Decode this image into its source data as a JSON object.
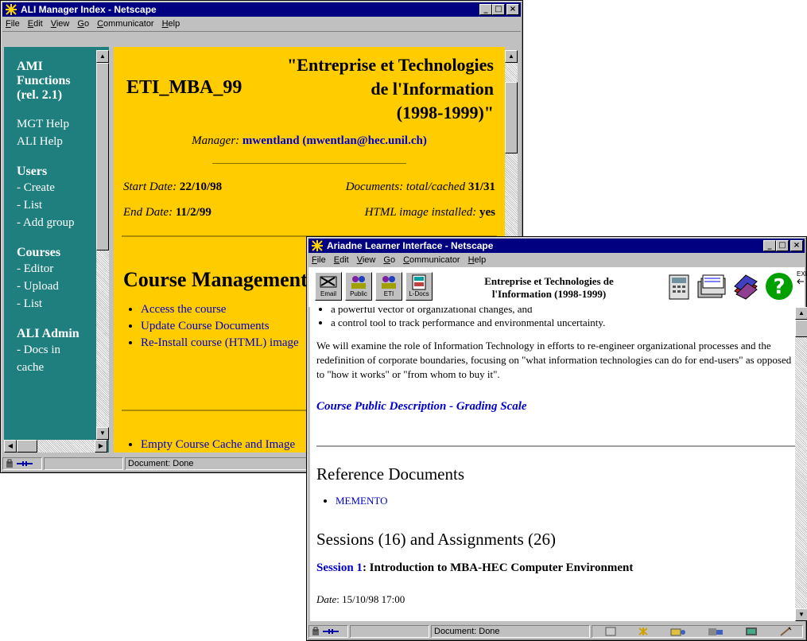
{
  "manager_window": {
    "title": "ALI Manager Index - Netscape",
    "menu": [
      "File",
      "Edit",
      "View",
      "Go",
      "Communicator",
      "Help"
    ],
    "status": "Document: Done",
    "sidebar": {
      "heading": [
        "AMI",
        "Functions",
        "(rel. 2.1)"
      ],
      "help_links": [
        "MGT Help",
        "ALI Help"
      ],
      "users_title": "Users",
      "users_items": [
        "- Create",
        "- List",
        "- Add group"
      ],
      "courses_title": "Courses",
      "courses_items": [
        "- Editor",
        "- Upload",
        "- List"
      ],
      "admin_title": "ALI Admin",
      "admin_items": [
        "- Docs in",
        "cache"
      ]
    },
    "main": {
      "course_code": "ETI_MBA_99",
      "course_title_lines": [
        "\"Entreprise et Technologies",
        "de l'Information",
        "(1998-1999)\""
      ],
      "manager_label": "Manager",
      "manager_name": "mwentland",
      "manager_email": "(mwentlan@hec.unil.ch)",
      "start_label": "Start Date",
      "start_value": "22/10/98",
      "end_label": "End Date",
      "end_value": "11/2/99",
      "docs_label": "Documents: total/cached",
      "docs_value": "31/31",
      "html_label": "HTML image installed",
      "html_value": "yes",
      "section_title": "Course Management:",
      "actions": [
        "Access the course",
        "Update Course Documents",
        "Re-Install course (HTML) image"
      ],
      "bottom_action": "Empty Course Cache and Image"
    }
  },
  "learner_window": {
    "title": "Ariadne Learner Interface - Netscape",
    "menu": [
      "File",
      "Edit",
      "View",
      "Go",
      "Communicator",
      "Help"
    ],
    "status": "Document: Done",
    "toolbar_buttons": [
      "Email",
      "Public",
      "ETI",
      "L-Docs"
    ],
    "header_title": [
      "Entreprise et Technologies de",
      "l'Information (1998-1999)"
    ],
    "exit_label": "EXIT",
    "content": {
      "bullets": [
        "a powerful vector of organizational changes, and",
        "a control tool to track performance and environmental uncertainty."
      ],
      "paragraph": "We will examine the role of Information Technology in efforts to re-engineer organizational processes and the redefinition of corporate boundaries, focusing on \"what information technologies can do for end-users\" as opposed to \"how it works\" or \"from whom to buy it\".",
      "public_link": "Course Public Description - Grading Scale",
      "ref_heading": "Reference Documents",
      "ref_items": [
        "MEMENTO"
      ],
      "sessions_heading": "Sessions (16) and Assignments (26)",
      "session_link": "Session 1",
      "session_title": ": Introduction to MBA-HEC Computer Environment",
      "date_label": "Date",
      "date_value": ": 15/10/98 17:00"
    }
  },
  "colors": {
    "title_bar": "#000080",
    "sidebar_bg": "#1f7f7f",
    "main_bg": "#ffcc00",
    "link": "#0000cc"
  }
}
